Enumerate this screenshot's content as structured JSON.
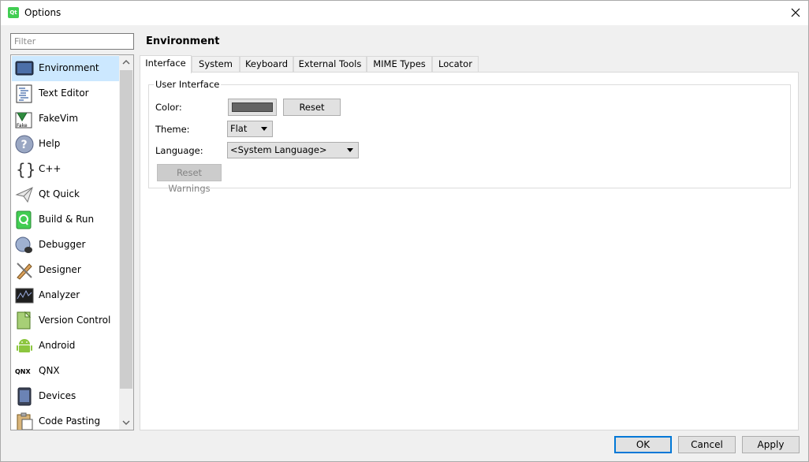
{
  "window": {
    "title": "Options"
  },
  "filter": {
    "placeholder": "Filter"
  },
  "sidebar": {
    "items": [
      {
        "label": "Environment",
        "icon": "monitor-icon",
        "selected": true
      },
      {
        "label": "Text Editor",
        "icon": "text-editor-icon"
      },
      {
        "label": "FakeVim",
        "icon": "fakevim-icon"
      },
      {
        "label": "Help",
        "icon": "help-icon"
      },
      {
        "label": "C++",
        "icon": "braces-icon"
      },
      {
        "label": "Qt Quick",
        "icon": "paper-plane-icon"
      },
      {
        "label": "Build & Run",
        "icon": "build-run-icon"
      },
      {
        "label": "Debugger",
        "icon": "debugger-icon"
      },
      {
        "label": "Designer",
        "icon": "designer-icon"
      },
      {
        "label": "Analyzer",
        "icon": "analyzer-icon"
      },
      {
        "label": "Version Control",
        "icon": "version-control-icon"
      },
      {
        "label": "Android",
        "icon": "android-icon"
      },
      {
        "label": "QNX",
        "icon": "qnx-icon"
      },
      {
        "label": "Devices",
        "icon": "devices-icon"
      },
      {
        "label": "Code Pasting",
        "icon": "code-pasting-icon"
      }
    ]
  },
  "main": {
    "title": "Environment",
    "tabs": [
      "Interface",
      "System",
      "Keyboard",
      "External Tools",
      "MIME Types",
      "Locator"
    ],
    "active_tab": "Interface",
    "group_title": "User Interface",
    "color_label": "Color:",
    "color_value": "#646464",
    "reset_label": "Reset",
    "theme_label": "Theme:",
    "theme_value": "Flat",
    "language_label": "Language:",
    "language_value": "<System Language>",
    "reset_warnings_label": "Reset Warnings"
  },
  "footer": {
    "ok_label": "OK",
    "cancel_label": "Cancel",
    "apply_label": "Apply"
  },
  "colors": {
    "selection": "#cce8ff",
    "accent": "#0078d7",
    "qt_green": "#41cd52"
  }
}
